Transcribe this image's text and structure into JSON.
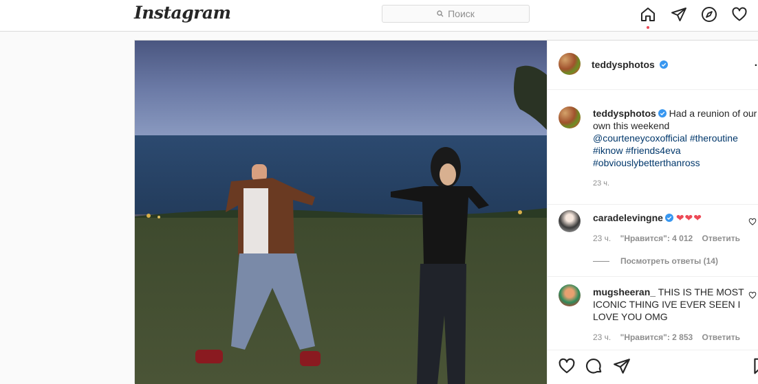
{
  "header": {
    "logo": "Instagram",
    "search_placeholder": "Поиск"
  },
  "post": {
    "author": "teddysphotos",
    "caption_author": "teddysphotos",
    "caption_text": "Had a reunion of our own this weekend",
    "caption_mention": "@courteneycoxofficial",
    "caption_tags": [
      "#theroutine",
      "#iknow",
      "#friends4eva",
      "#obviouslybetterthanross"
    ],
    "caption_time": "23 ч."
  },
  "comments": [
    {
      "user": "caradelevingne",
      "text": "❤❤❤",
      "time": "23 ч.",
      "likes": "\"Нравится\": 4 012",
      "reply": "Ответить",
      "view_replies": "Посмотреть ответы (14)"
    },
    {
      "user": "mugsheeran_",
      "text": "THIS IS THE MOST ICONIC THING IVE EVER SEEN I LOVE YOU OMG",
      "time": "23 ч.",
      "likes": "\"Нравится\": 2 853",
      "reply": "Ответить"
    }
  ],
  "colors": {
    "accent_link": "#00376b",
    "notification_dot": "#ed4956",
    "verified": "#3897f0",
    "heart": "#ed4956"
  },
  "icons": [
    "home-icon",
    "direct-icon",
    "explore-icon",
    "activity-heart-icon",
    "like-icon",
    "comment-icon",
    "share-icon",
    "save-icon"
  ]
}
